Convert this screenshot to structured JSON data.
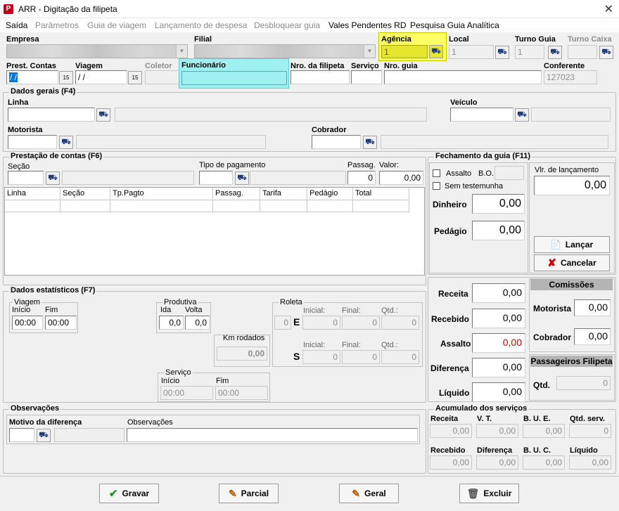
{
  "window": {
    "title": "ARR - Digitação da filipeta",
    "close": "✕",
    "app_icon": "P"
  },
  "menu": [
    "Saída",
    "Parâmetros",
    "Guia de viagem",
    "Lançamento de despesa",
    "Desbloquear guia",
    "Vales Pendentes RD",
    "Pesquisa Guia Analítica"
  ],
  "header": {
    "empresa": "Empresa",
    "filial": "Filial",
    "agencia": "Agência",
    "agencia_value": "1",
    "local": "Local",
    "local_value": "1",
    "turno_guia": "Turno Guia",
    "turno_guia_value": "1",
    "turno_caixa": "Turno Caixa",
    "prest_contas": "Prest. Contas",
    "prest_value": " / /",
    "viagem": "Viagem",
    "viagem_value": " / /",
    "coletor": "Coletor",
    "funcionario": "Funcionário",
    "nro_filipeta": "Nro. da filipeta",
    "servico": "Serviço",
    "nro_guia": "Nro. guia",
    "conferente": "Conferente",
    "conferente_value": "127023",
    "cal": "15"
  },
  "dados_gerais": {
    "title": "Dados gerais (F4)",
    "linha": "Linha",
    "veiculo": "Veículo",
    "motorista": "Motorista",
    "cobrador": "Cobrador"
  },
  "prestacao": {
    "title": "Prestação de contas (F6)",
    "secao": "Seção",
    "tipo_pagamento": "Tipo de pagamento",
    "passag": "Passag.",
    "valor": "Valor:",
    "passag_value": "0",
    "valor_value": "0,00",
    "columns": [
      "Linha",
      "Seção",
      "Tp.Pagto",
      "Passag.",
      "Tarifa",
      "Pedágio",
      "Total"
    ]
  },
  "fechamento": {
    "title": "Fechamento da guia (F11)",
    "assalto": "Assalto",
    "bo": "B.O.",
    "sem_testemunha": "Sem testemunha",
    "dinheiro": "Dinheiro",
    "dinheiro_value": "0,00",
    "pedagio": "Pedágio",
    "pedagio_value": "0,00",
    "vlr_lancamento": "Vlr. de lançamento",
    "vlr_value": "0,00",
    "lancar": "Lançar",
    "cancelar": "Cancelar"
  },
  "totais": {
    "receita": "Receita",
    "receita_value": "0,00",
    "recebido": "Recebido",
    "recebido_value": "0,00",
    "assalto": "Assalto",
    "assalto_value": "0,00",
    "diferenca": "Diferença",
    "diferenca_value": "0,00",
    "liquido": "Líquido",
    "liquido_value": "0,00"
  },
  "comissoes": {
    "title": "Comissões",
    "motorista": "Motorista",
    "motorista_value": "0,00",
    "cobrador": "Cobrador",
    "cobrador_value": "0,00",
    "passageiros_title": "Passageiros Filipeta",
    "qtd": "Qtd.",
    "qtd_value": "0"
  },
  "estatisticos": {
    "title": "Dados estatísticos (F7)",
    "viagem": "Viagem",
    "inicio": "Início",
    "fim": "Fim",
    "inicio_value": "00:00",
    "fim_value": "00:00",
    "produtiva": "Produtiva",
    "ida": "Ida",
    "volta": "Volta",
    "ida_value": "0,0",
    "volta_value": "0,0",
    "km_rodados": "Km rodados",
    "km_value": "0,00",
    "roleta": "Roleta",
    "roleta_value": "0",
    "e": "E",
    "s": "S",
    "inicial": "Inicial:",
    "final": "Final:",
    "qtd": "Qtd.:",
    "zero": "0",
    "servico": "Serviço",
    "serv_inicio_value": "00:00",
    "serv_fim_value": "00:00"
  },
  "observacoes": {
    "title": "Observações",
    "motivo": "Motivo da diferença",
    "observacoes": "Observações"
  },
  "acumulado": {
    "title": "Acumulado dos serviços",
    "receita": "Receita",
    "vt": "V. T.",
    "bue": "B. U. E.",
    "qtd_serv": "Qtd. serv.",
    "recebido": "Recebido",
    "diferenca": "Diferença",
    "buc": "B. U. C.",
    "liquido": "Líquido",
    "v000": "0,00",
    "v0": "0"
  },
  "buttons": {
    "gravar": "Gravar",
    "parcial": "Parcial",
    "geral": "Geral",
    "excluir": "Excluir"
  },
  "icons": {
    "binoculars": "⛟"
  }
}
